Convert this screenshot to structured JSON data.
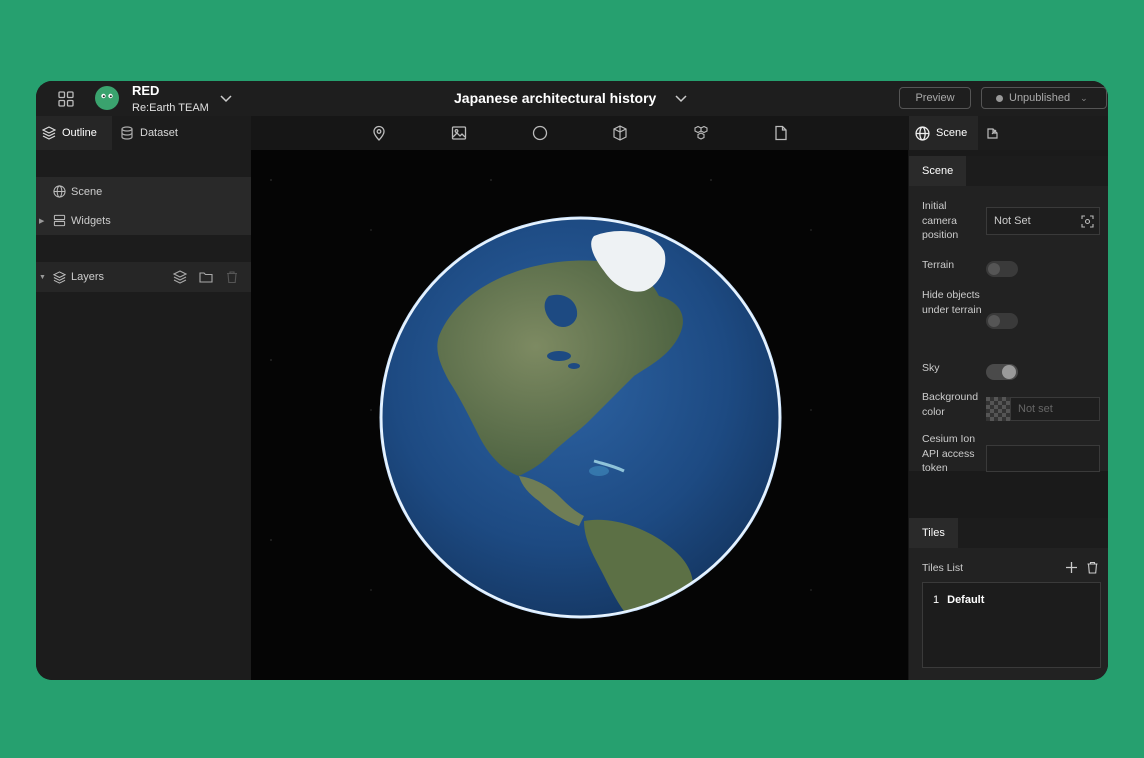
{
  "header": {
    "project_name": "RED",
    "team_name": "Re:Earth TEAM",
    "scene_title": "Japanese architectural history",
    "preview_label": "Preview",
    "publish_label": "Unpublished"
  },
  "left_panel": {
    "tabs": [
      {
        "label": "Outline",
        "icon": "layers-icon",
        "active": true
      },
      {
        "label": "Dataset",
        "icon": "database-icon",
        "active": false
      }
    ],
    "items": [
      {
        "label": "Scene",
        "icon": "globe-icon"
      },
      {
        "label": "Widgets",
        "icon": "widgets-icon"
      }
    ],
    "layers_label": "Layers"
  },
  "toolbar": {
    "tools": [
      "pin-icon",
      "image-icon",
      "circle-icon",
      "cube-icon",
      "model-icon",
      "file-icon"
    ]
  },
  "right_panel": {
    "tab_label": "Scene",
    "scene_group": {
      "title": "Scene",
      "camera_label": "Initial camera position",
      "camera_value": "Not Set",
      "terrain_label": "Terrain",
      "terrain_on": false,
      "hide_label": "Hide objects under terrain",
      "hide_on": false,
      "sky_label": "Sky",
      "sky_on": true,
      "bg_label": "Background color",
      "bg_placeholder": "Not set",
      "token_label": "Cesium Ion API access token",
      "token_value": ""
    },
    "tiles_group": {
      "title": "Tiles",
      "list_label": "Tiles List",
      "items": [
        {
          "index": "1",
          "name": "Default"
        }
      ]
    }
  },
  "colors": {
    "background": "#26a06f",
    "panel": "#1c1c1c",
    "accent": "#3aa36e"
  }
}
